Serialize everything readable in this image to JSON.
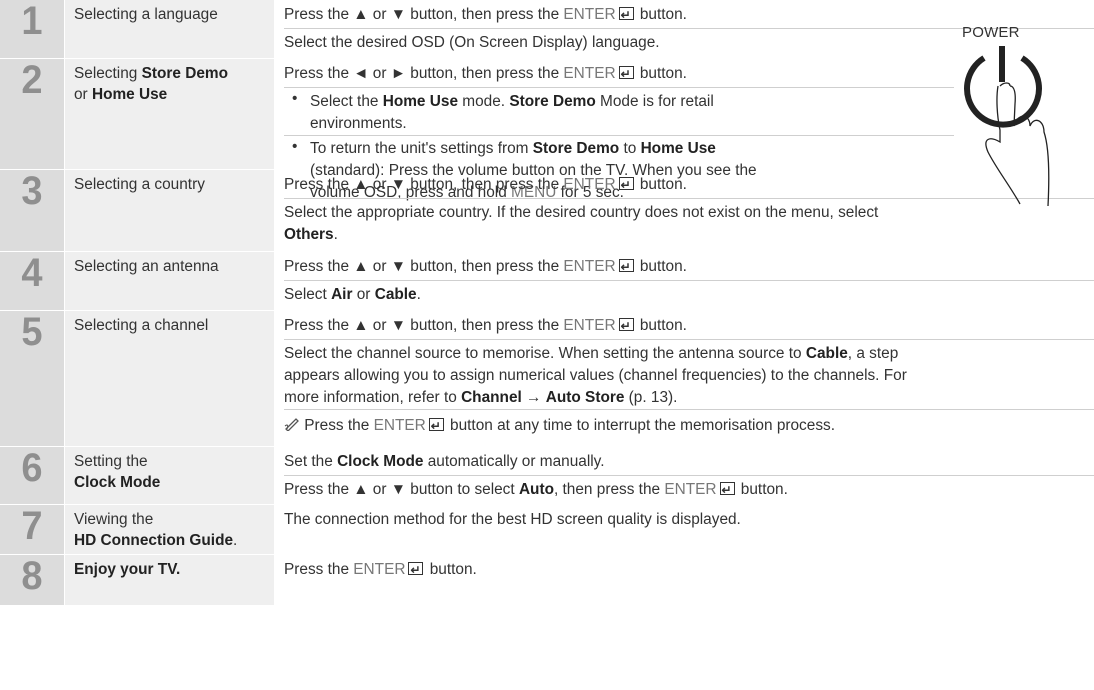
{
  "power_label": "POWER",
  "enter_label": "ENTER",
  "steps": [
    {
      "num": "1",
      "title": "Selecting a language",
      "l1": "Press the ▲ or ▼ button, then press the ",
      "l1b": " button.",
      "l2": "Select the desired OSD (On Screen Display) language."
    },
    {
      "num": "2",
      "t1": "Selecting ",
      "t1b": "Store Demo",
      "t2": "or ",
      "t2b": "Home Use",
      "l1": "Press the ◄ or ► button, then press the ",
      "l1b": " button.",
      "b1a": "Select the ",
      "b1b": "Home Use",
      "b1c": " mode. ",
      "b1d": "Store Demo",
      "b1e": " Mode is for retail",
      "b1f": "environments.",
      "b2a": "To return the unit's settings from ",
      "b2b": "Store Demo",
      "b2c": " to ",
      "b2d": "Home Use",
      "b2e": "(standard): Press the volume button on the TV. When you see the",
      "b2f": "volume OSD, press and hold ",
      "b2g": "MENU",
      "b2h": " for 5 sec."
    },
    {
      "num": "3",
      "title": "Selecting a country",
      "l1": "Press the ▲ or ▼ button, then press the ",
      "l1b": " button.",
      "l2": "Select the appropriate country. If the desired country does not exist on the menu, select",
      "l3": "Others",
      "l3b": "."
    },
    {
      "num": "4",
      "title": "Selecting an antenna",
      "l1": "Press the ▲ or ▼ button, then press the ",
      "l1b": " button.",
      "l2a": "Select ",
      "l2b": "Air",
      "l2c": " or ",
      "l2d": "Cable",
      "l2e": "."
    },
    {
      "num": "5",
      "title": "Selecting a channel",
      "l1": "Press the ▲ or ▼ button, then press the ",
      "l1b": " button.",
      "l2a": "Select the channel source to memorise. When setting the antenna source to ",
      "l2b": "Cable",
      "l2c": ", a step",
      "l3": "appears allowing you to assign numerical values (channel frequencies) to the channels. For",
      "l4a": "more information, refer to ",
      "l4b": "Channel",
      "l4c": " → ",
      "l4d": "Auto Store",
      "l4e": " (p. 13).",
      "note_a": " Press the ",
      "note_b": " button at any time to interrupt the memorisation process."
    },
    {
      "num": "6",
      "t1": "Setting the",
      "t2b": "Clock Mode",
      "l1a": "Set the ",
      "l1b": "Clock Mode",
      "l1c": " automatically or manually.",
      "l2a": "Press the ▲ or ▼ button to select ",
      "l2b": "Auto",
      "l2c": ", then press the ",
      "l2d": " button."
    },
    {
      "num": "7",
      "t1": "Viewing the",
      "t2b": "HD Connection Guide",
      "t2c": ".",
      "l1": "The connection method for the best HD screen quality is displayed."
    },
    {
      "num": "8",
      "title": "Enjoy your TV.",
      "l1": "Press the ",
      "l1b": " button."
    }
  ]
}
